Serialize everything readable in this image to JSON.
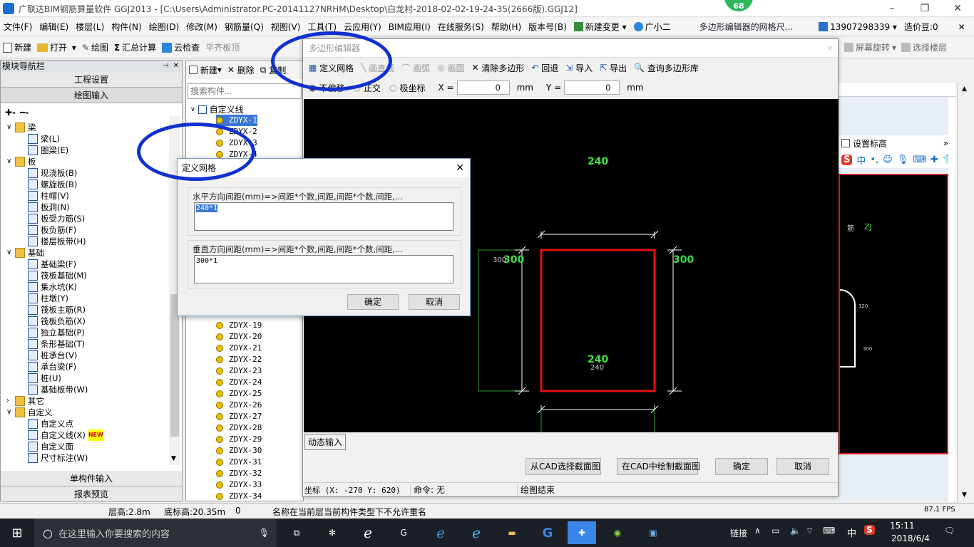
{
  "window": {
    "title": "广联达BIM钢筋算量软件 GGJ2013 - [C:\\Users\\Administrator.PC-20141127NRHM\\Desktop\\白龙村-2018-02-02-19-24-35(2666版).GGJ12]",
    "badge": "68"
  },
  "menubar": {
    "items": [
      "文件(F)",
      "编辑(E)",
      "楼层(L)",
      "构件(N)",
      "绘图(D)",
      "修改(M)",
      "钢筋量(Q)",
      "视图(V)",
      "工具(T)",
      "云应用(Y)",
      "BIM应用(I)",
      "在线服务(S)",
      "帮助(H)",
      "版本号(B)"
    ],
    "new_change": "新建变更",
    "assistant": "广小二",
    "notice": "多边形编辑器的网格尺...",
    "phone": "13907298339",
    "price": "造价豆:0"
  },
  "toolbar": {
    "new": "新建",
    "open": "打开",
    "draw": "绘图",
    "sum": "汇总计算",
    "cloud_check": "云检查",
    "flatten": "平齐板顶",
    "rotate": "屏幕旋转",
    "select_floor": "选择楼层"
  },
  "nav": {
    "title": "模块导航栏",
    "project_settings": "工程设置",
    "drawing_input": "绘图输入",
    "tree": [
      {
        "label": "梁",
        "level": 0,
        "expanded": true
      },
      {
        "label": "梁(L)",
        "level": 1
      },
      {
        "label": "圈梁(E)",
        "level": 1
      },
      {
        "label": "板",
        "level": 0,
        "expanded": true
      },
      {
        "label": "现浇板(B)",
        "level": 1
      },
      {
        "label": "螺旋板(B)",
        "level": 1
      },
      {
        "label": "柱帽(V)",
        "level": 1
      },
      {
        "label": "板洞(N)",
        "level": 1
      },
      {
        "label": "板受力筋(S)",
        "level": 1
      },
      {
        "label": "板负筋(F)",
        "level": 1
      },
      {
        "label": "楼层板带(H)",
        "level": 1
      },
      {
        "label": "基础",
        "level": 0,
        "expanded": true
      },
      {
        "label": "基础梁(F)",
        "level": 1
      },
      {
        "label": "筏板基础(M)",
        "level": 1
      },
      {
        "label": "集水坑(K)",
        "level": 1
      },
      {
        "label": "柱墩(Y)",
        "level": 1
      },
      {
        "label": "筏板主筋(R)",
        "level": 1
      },
      {
        "label": "筏板负筋(X)",
        "level": 1
      },
      {
        "label": "独立基础(P)",
        "level": 1
      },
      {
        "label": "条形基础(T)",
        "level": 1
      },
      {
        "label": "桩承台(V)",
        "level": 1
      },
      {
        "label": "承台梁(F)",
        "level": 1
      },
      {
        "label": "桩(U)",
        "level": 1
      },
      {
        "label": "基础板带(W)",
        "level": 1
      },
      {
        "label": "其它",
        "level": 0,
        "expanded": false
      },
      {
        "label": "自定义",
        "level": 0,
        "expanded": true
      },
      {
        "label": "自定义点",
        "level": 1
      },
      {
        "label": "自定义线(X)",
        "level": 1,
        "new": "NEW"
      },
      {
        "label": "自定义面",
        "level": 1
      },
      {
        "label": "尺寸标注(W)",
        "level": 1
      }
    ],
    "single_input": "单构件输入",
    "report": "报表预览"
  },
  "complist": {
    "new": "新建",
    "delete": "删除",
    "copy": "复制",
    "search_placeholder": "搜索构件...",
    "root": "自定义线",
    "items_top": [
      "ZDYX-1",
      "ZDYX-2",
      "ZDYX-3",
      "ZDYX-4"
    ],
    "items_bottom": [
      "ZDYX-19",
      "ZDYX-20",
      "ZDYX-21",
      "ZDYX-22",
      "ZDYX-23",
      "ZDYX-24",
      "ZDYX-25",
      "ZDYX-26",
      "ZDYX-27",
      "ZDYX-28",
      "ZDYX-29",
      "ZDYX-30",
      "ZDYX-31",
      "ZDYX-32",
      "ZDYX-33",
      "ZDYX-34"
    ]
  },
  "poly": {
    "title": "多边形编辑器",
    "define_grid": "定义网格",
    "draw_line": "画直线",
    "draw_arc": "画弧",
    "draw_circle": "画圆",
    "clear": "清除多边形",
    "undo": "回退",
    "import": "导入",
    "export": "导出",
    "query_lib": "查询多边形库",
    "no_offset": "不偏移",
    "ortho": "正交",
    "polar": "极坐标",
    "x_label": "X =",
    "x_value": "0",
    "y_label": "Y =",
    "y_value": "0",
    "unit": "mm",
    "dim_top": "240",
    "dim_bottom": "240",
    "dim_bottom_small": "240",
    "dim_left": "300",
    "dim_left_small": "300",
    "dim_right": "300",
    "dyn_input": "动态输入",
    "btn_select_cad": "从CAD选择截面图",
    "btn_draw_cad": "在CAD中绘制截面图",
    "btn_ok": "确定",
    "btn_cancel": "取消",
    "status_coord": "坐标 (X: -270 Y: 620)",
    "status_cmd": "命令: 无",
    "status_end": "绘图结束"
  },
  "grid": {
    "title": "定义网格",
    "h_label": "水平方向间距(mm)=>间距*个数,间距,间距*个数,间距,...",
    "h_value": "240*1",
    "v_label": "垂直方向间距(mm)=>间距*个数,间距,间距*个数,间距,...",
    "v_value": "300*1",
    "ok": "确定",
    "cancel": "取消"
  },
  "right": {
    "set_elev": "设置标高",
    "zj": "ZJ",
    "side": "筋",
    "dim_small1": "120",
    "dim_small2": "300"
  },
  "statusbar": {
    "floor_h": "层高:2.8m",
    "base_h": "底标高:20.35m",
    "zero": "0",
    "msg": "名称在当前层当前构件类型下不允许重名",
    "fps": "87.1 FPS"
  },
  "taskbar": {
    "search_placeholder": "在这里输入你要搜索的内容",
    "link": "链接",
    "ime": "中",
    "time": "15:11",
    "date": "2018/6/4"
  }
}
